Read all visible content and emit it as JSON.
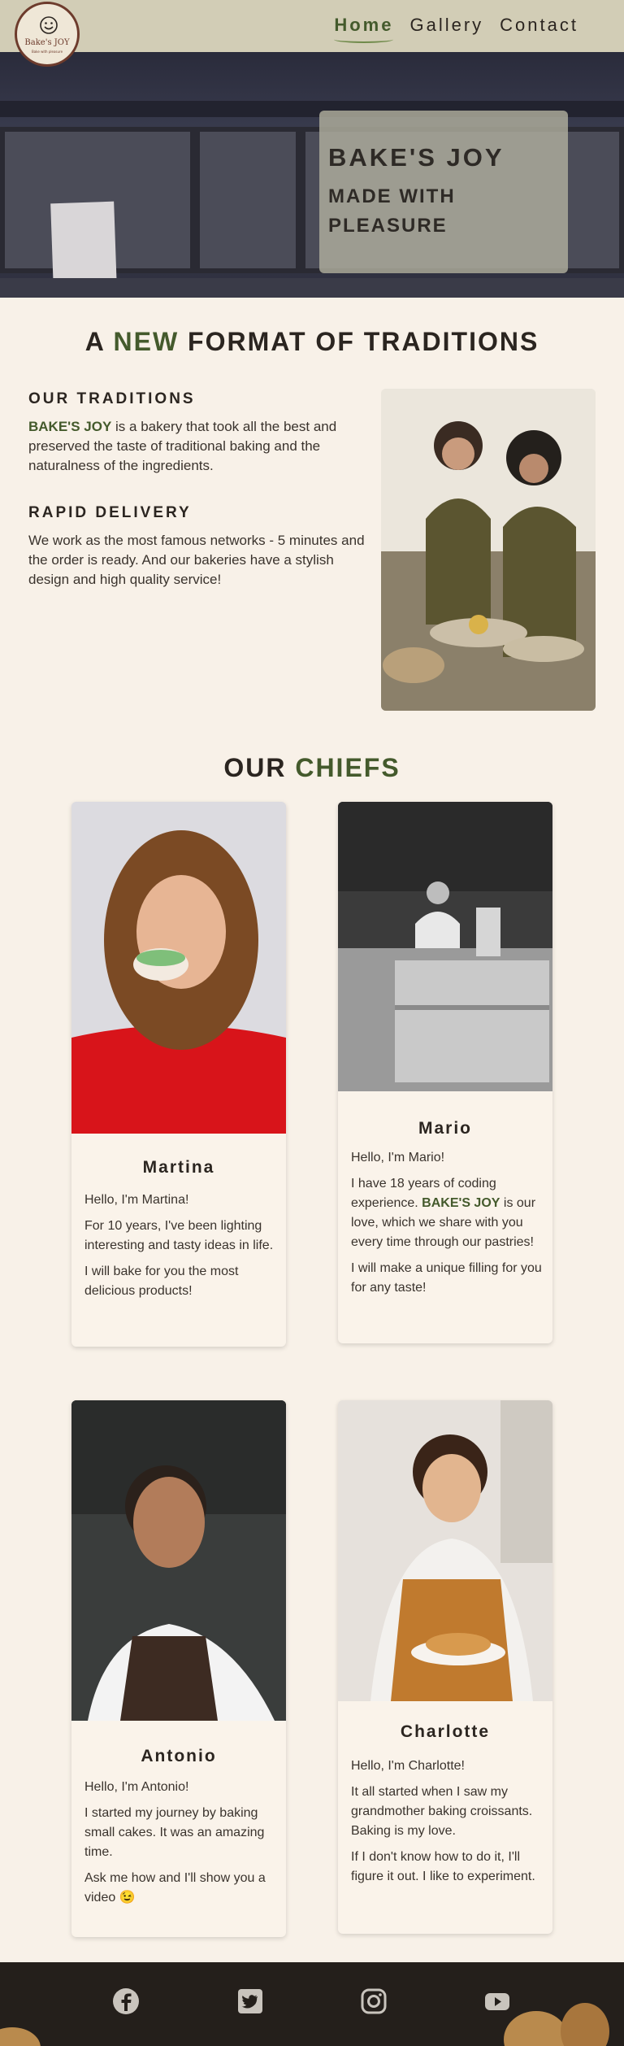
{
  "header": {
    "logo": {
      "name": "Bake's JOY",
      "tagline": "Bake with pleasure"
    },
    "nav": [
      {
        "label": "Home",
        "active": true
      },
      {
        "label": "Gallery",
        "active": false
      },
      {
        "label": "Contact",
        "active": false
      }
    ]
  },
  "hero": {
    "title": "BAKE'S JOY",
    "subtitle": "MADE WITH PLEASURE"
  },
  "about": {
    "heading_pre": "A",
    "heading_accent": "NEW",
    "heading_post": "FORMAT OF TRADITIONS",
    "traditions": {
      "title": "OUR TRADITIONS",
      "brand": "BAKE'S JOY",
      "text": " is a bakery that took all the best and preserved the taste of traditional baking and the naturalness of the ingredients."
    },
    "delivery": {
      "title": "RAPID DELIVERY",
      "text": "We work as the most famous networks - 5 minutes and the order is ready. And our bakeries have a stylish design and high quality service!"
    }
  },
  "chiefs": {
    "heading_pre": "OUR",
    "heading_accent": "CHIEFS",
    "cards": [
      {
        "name": "Martina",
        "greeting": "Hello, I'm Martina!",
        "p1": "For 10 years, I've been lighting interesting and tasty ideas in life.",
        "p2": "I will bake for you the most delicious products!"
      },
      {
        "name": "Mario",
        "greeting": "Hello, I'm Mario!",
        "p1_pre": "I have 18 years of coding experience. ",
        "p1_brand": "BAKE'S JOY",
        "p1_post": " is our love, which we share with you every time through our pastries!",
        "p2": "I will make a unique filling for you for any taste!"
      },
      {
        "name": "Antonio",
        "greeting": "Hello, I'm Antonio!",
        "p1": "I started my journey by baking small cakes. It was an amazing time.",
        "p2": "Ask me how and I'll show you a video 😉"
      },
      {
        "name": "Charlotte",
        "greeting": "Hello, I'm Charlotte!",
        "p1": "It all started when I saw my grandmother baking croissants. Baking is my love.",
        "p2": "If I don't know how to do it, I'll figure it out. I like to experiment."
      }
    ]
  },
  "footer": {
    "social": [
      "facebook-icon",
      "twitter-icon",
      "instagram-icon",
      "youtube-icon"
    ]
  },
  "colors": {
    "accent": "#445a2c",
    "background": "#f8f1e8",
    "header": "#d2cdb6",
    "footer": "#241f1b"
  }
}
